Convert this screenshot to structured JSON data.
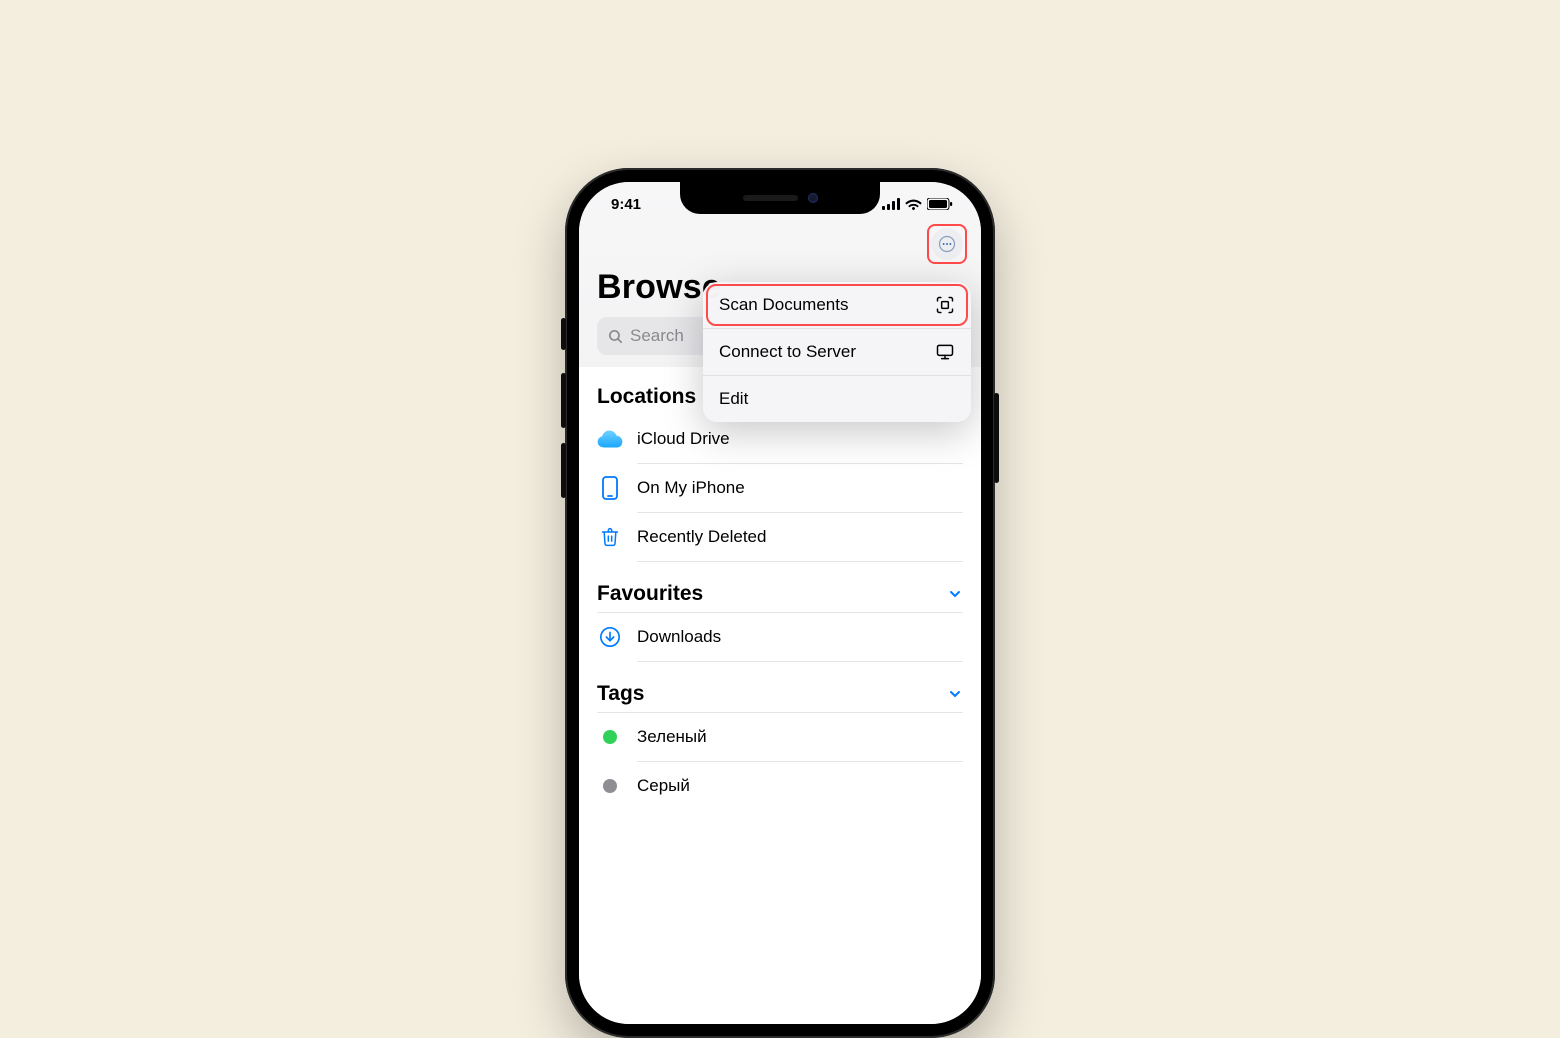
{
  "status": {
    "time": "9:41"
  },
  "nav": {
    "title": "Browse",
    "search_placeholder": "Search"
  },
  "menu": {
    "items": [
      {
        "label": "Scan Documents",
        "icon": "scan-icon",
        "highlight": true
      },
      {
        "label": "Connect to Server",
        "icon": "server-icon",
        "highlight": false
      },
      {
        "label": "Edit",
        "icon": "",
        "highlight": false
      }
    ]
  },
  "sections": {
    "locations": {
      "title": "Locations",
      "items": [
        {
          "label": "iCloud Drive",
          "icon": "cloud-icon"
        },
        {
          "label": "On My iPhone",
          "icon": "phone-icon"
        },
        {
          "label": "Recently Deleted",
          "icon": "trash-icon"
        }
      ]
    },
    "favourites": {
      "title": "Favourites",
      "items": [
        {
          "label": "Downloads",
          "icon": "download-icon"
        }
      ]
    },
    "tags": {
      "title": "Tags",
      "items": [
        {
          "label": "Зеленый",
          "color": "green"
        },
        {
          "label": "Серый",
          "color": "gray"
        }
      ]
    }
  }
}
